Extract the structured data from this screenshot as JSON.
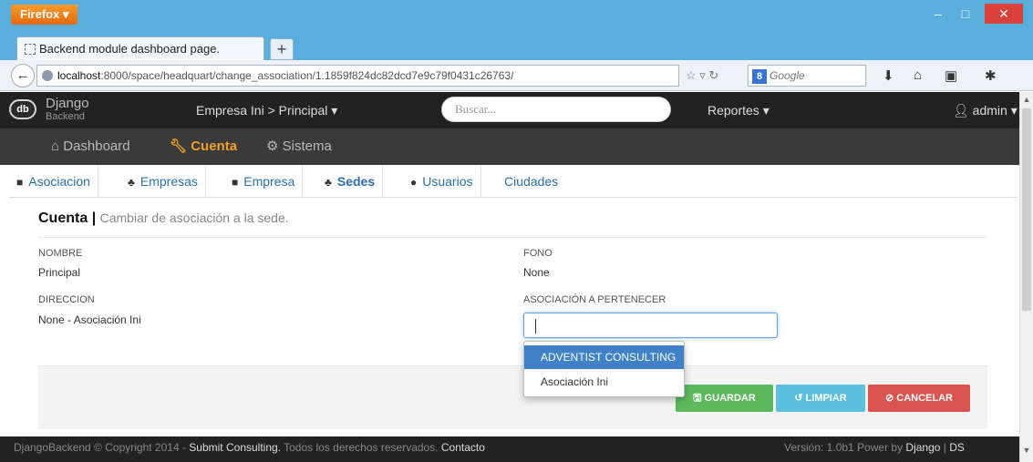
{
  "browser": {
    "menu_button": "Firefox ▾",
    "tab_title": "Backend module dashboard page.",
    "new_tab": "+",
    "url_host": "localhost",
    "url_rest": ":8000/space/headquart/change_association/1.1859f824dc82dcd7e9c79f0431c26763/",
    "search_engine": "Google",
    "minimize": "–",
    "maximize": "□",
    "close": "✕"
  },
  "app": {
    "logo_abbr": "db",
    "logo_name": "Django",
    "logo_sub": "Backend",
    "company_selector": "Empresa Ini > Principal ▾",
    "search_placeholder": "Buscar...",
    "reports_menu": "Reportes ▾",
    "user_menu": "admin ▾"
  },
  "main_nav": [
    {
      "label": "Dashboard",
      "icon": "home-icon"
    },
    {
      "label": "Cuenta",
      "icon": "wrench-icon",
      "active": true
    },
    {
      "label": "Sistema",
      "icon": "cogs-icon"
    }
  ],
  "sub_nav": [
    {
      "label": "Asociacion",
      "icon": "briefcase-icon"
    },
    {
      "label": "Empresas",
      "icon": "sitemap-icon"
    },
    {
      "label": "Empresa",
      "icon": "briefcase-icon"
    },
    {
      "label": "Sedes",
      "icon": "sitemap-icon",
      "active": true
    },
    {
      "label": "Usuarios",
      "icon": "user-icon"
    },
    {
      "label": "Ciudades",
      "icon": ""
    }
  ],
  "panel": {
    "title": "Cuenta",
    "separator": "|",
    "subtitle": "Cambiar de asociación a la sede."
  },
  "fields": {
    "nombre_label": "NOMBRE",
    "nombre_value": "Principal",
    "direccion_label": "DIRECCION",
    "direccion_value": "None - Asociación Ini",
    "fono_label": "FONO",
    "fono_value": "None",
    "asociacion_label": "ASOCIACIÓN A PERTENECER",
    "asociacion_value": ""
  },
  "dropdown_options": [
    "ADVENTIST CONSULTING",
    "Asociación Ini"
  ],
  "buttons": {
    "save": "GUARDAR",
    "clear": "LIMPIAR",
    "cancel": "CANCELAR"
  },
  "footer": {
    "left_prefix": "DjangoBackend © Copyright 2014 - ",
    "company": "Submit Consulting.",
    "rights": " Todos los derechos reservados. ",
    "contact": "Contacto",
    "version_prefix": "Versión: 1.0b1 Power by ",
    "django": "Django",
    "sep": " | ",
    "ds": "DS"
  },
  "colors": {
    "accent": "#f0a028",
    "link": "#2a6fb3",
    "save": "#5cb85c",
    "clear": "#5bc0de",
    "cancel": "#d9534f",
    "selected_option": "#3f82c8"
  }
}
